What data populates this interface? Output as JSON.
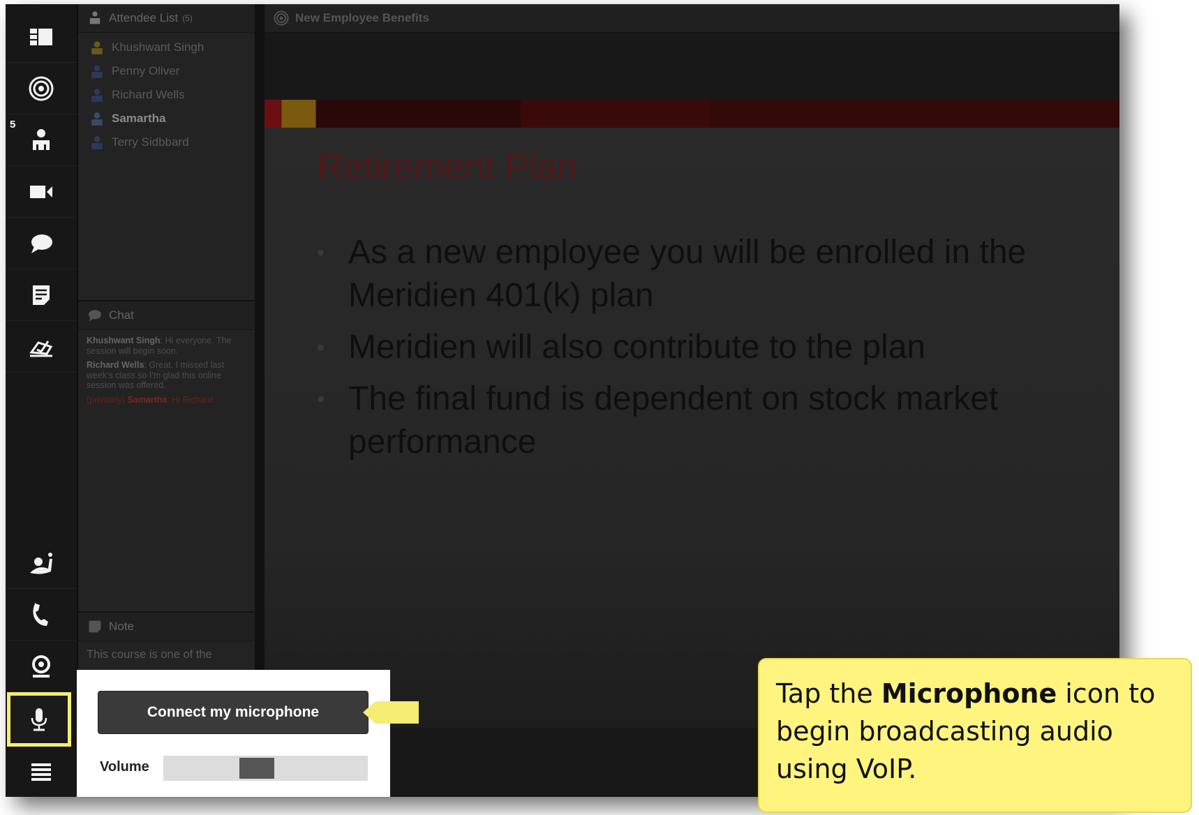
{
  "toolbar": {
    "attendee_badge": "5"
  },
  "attendees": {
    "title": "Attendee List",
    "count": "(5)",
    "items": [
      {
        "name": "Khushwant Singh",
        "bold": false
      },
      {
        "name": "Penny Oliver",
        "bold": false
      },
      {
        "name": "Richard Wells",
        "bold": false
      },
      {
        "name": "Samartha",
        "bold": true
      },
      {
        "name": "Terry Sidbbard",
        "bold": false
      }
    ]
  },
  "chat": {
    "title": "Chat",
    "messages": [
      {
        "sender": "Khushwant Singh",
        "text": ": Hi everyone. The session will begin soon."
      },
      {
        "sender": "Richard Wells",
        "text": ": Great. I missed last week's class so I'm glad this online session was offered."
      },
      {
        "prefix": "(privately) ",
        "sender": "Samartha",
        "text": ": Hi Richard"
      }
    ]
  },
  "note": {
    "title": "Note",
    "text": "This course is one of the"
  },
  "content": {
    "title": "New Employee Benefits"
  },
  "slide": {
    "title": "Retirement Plan",
    "bullets": [
      "As a new employee you will be enrolled in the Meridien 401(k) plan",
      "Meridien will also contribute to the plan",
      "The final fund is dependent on stock market performance"
    ]
  },
  "mic_popup": {
    "connect_label": "Connect my microphone",
    "volume_label": "Volume",
    "volume_level": 0.45
  },
  "tooltip": {
    "pre": "Tap the ",
    "bold": "Microphone",
    "post": " icon to begin broadcasting audio using VoIP."
  },
  "colors": {
    "tooltip_bg": "#fff47e",
    "highlight": "#f5ec72",
    "slide_title": "#511818"
  }
}
